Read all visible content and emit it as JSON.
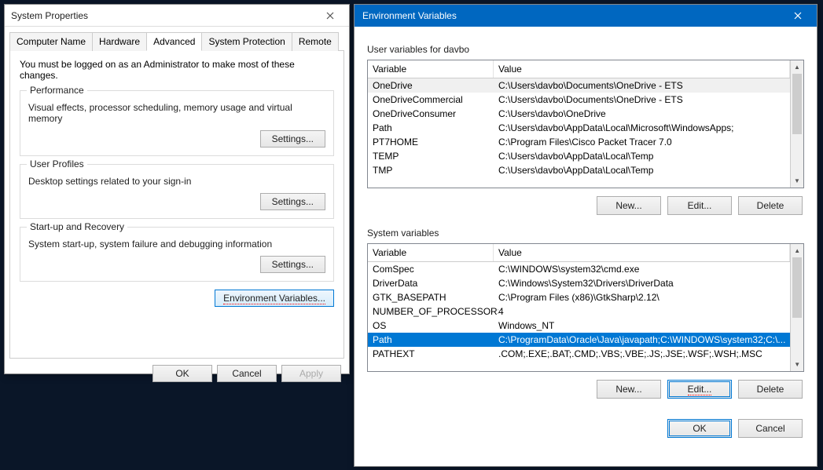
{
  "sysprop": {
    "title": "System Properties",
    "tabs": [
      "Computer Name",
      "Hardware",
      "Advanced",
      "System Protection",
      "Remote"
    ],
    "active_tab_index": 2,
    "admin_msg": "You must be logged on as an Administrator to make most of these changes.",
    "perf": {
      "title": "Performance",
      "desc": "Visual effects, processor scheduling, memory usage and virtual memory",
      "btn": "Settings..."
    },
    "profiles": {
      "title": "User Profiles",
      "desc": "Desktop settings related to your sign-in",
      "btn": "Settings..."
    },
    "startup": {
      "title": "Start-up and Recovery",
      "desc": "System start-up, system failure and debugging information",
      "btn": "Settings..."
    },
    "envvar_btn": "Environment Variables...",
    "ok": "OK",
    "cancel": "Cancel",
    "apply": "Apply"
  },
  "envvar": {
    "title": "Environment Variables",
    "user_section_title": "User variables for davbo",
    "system_section_title": "System variables",
    "columns": {
      "var": "Variable",
      "val": "Value"
    },
    "user_vars": [
      {
        "name": "OneDrive",
        "value": "C:\\Users\\davbo\\Documents\\OneDrive - ETS"
      },
      {
        "name": "OneDriveCommercial",
        "value": "C:\\Users\\davbo\\Documents\\OneDrive - ETS"
      },
      {
        "name": "OneDriveConsumer",
        "value": "C:\\Users\\davbo\\OneDrive"
      },
      {
        "name": "Path",
        "value": "C:\\Users\\davbo\\AppData\\Local\\Microsoft\\WindowsApps;"
      },
      {
        "name": "PT7HOME",
        "value": "C:\\Program Files\\Cisco Packet Tracer 7.0"
      },
      {
        "name": "TEMP",
        "value": "C:\\Users\\davbo\\AppData\\Local\\Temp"
      },
      {
        "name": "TMP",
        "value": "C:\\Users\\davbo\\AppData\\Local\\Temp"
      }
    ],
    "system_vars": [
      {
        "name": "ComSpec",
        "value": "C:\\WINDOWS\\system32\\cmd.exe"
      },
      {
        "name": "DriverData",
        "value": "C:\\Windows\\System32\\Drivers\\DriverData"
      },
      {
        "name": "GTK_BASEPATH",
        "value": "C:\\Program Files (x86)\\GtkSharp\\2.12\\"
      },
      {
        "name": "NUMBER_OF_PROCESSORS",
        "value": "4"
      },
      {
        "name": "OS",
        "value": "Windows_NT"
      },
      {
        "name": "Path",
        "value": "C:\\ProgramData\\Oracle\\Java\\javapath;C:\\WINDOWS\\system32;C:\\..."
      },
      {
        "name": "PATHEXT",
        "value": ".COM;.EXE;.BAT;.CMD;.VBS;.VBE;.JS;.JSE;.WSF;.WSH;.MSC"
      }
    ],
    "system_selected_index": 5,
    "btn_new": "New...",
    "btn_edit": "Edit...",
    "btn_delete": "Delete",
    "ok": "OK",
    "cancel": "Cancel"
  }
}
